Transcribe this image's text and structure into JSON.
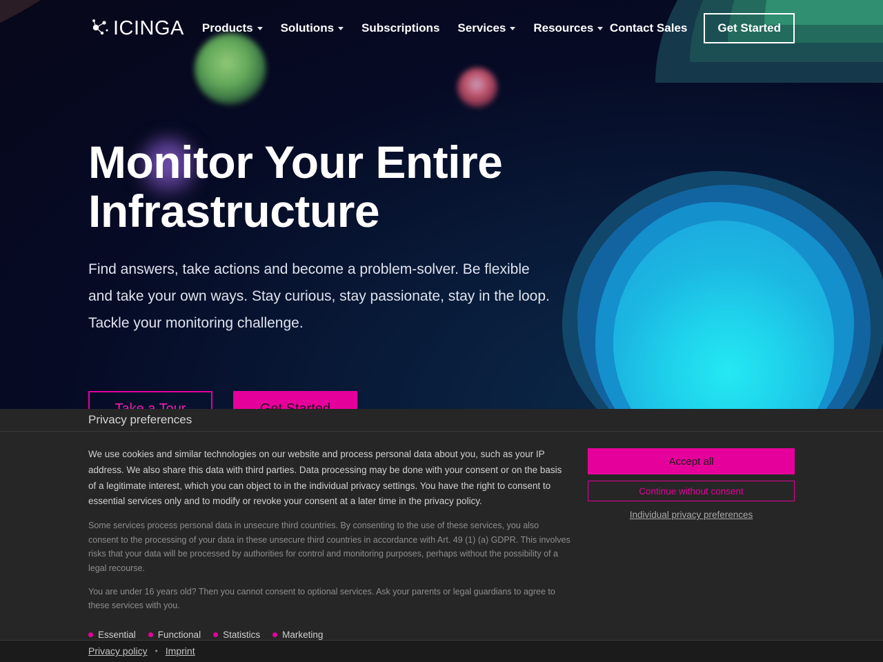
{
  "header": {
    "logo_text": "ICINGA",
    "logo_icon": "network-nodes-icon",
    "nav": [
      {
        "label": "Products",
        "has_caret": true
      },
      {
        "label": "Solutions",
        "has_caret": true
      },
      {
        "label": "Subscriptions",
        "has_caret": false
      },
      {
        "label": "Services",
        "has_caret": true
      },
      {
        "label": "Resources",
        "has_caret": true
      }
    ],
    "contact_sales": "Contact Sales",
    "get_started": "Get Started"
  },
  "hero": {
    "title": "Monitor Your Entire Infrastructure",
    "subtitle": "Find answers, take actions and become a problem-solver. Be flexible and take your own ways. Stay curious, stay passionate, stay in the loop. Tackle your monitoring challenge.",
    "cta_primary": "Take a Tour",
    "cta_secondary": "Get Started"
  },
  "privacy": {
    "heading": "Privacy preferences",
    "paragraph_main": "We use cookies and similar technologies on our website and process personal data about you, such as your IP address. We also share this data with third parties. Data processing may be done with your consent or on the basis of a legitimate interest, which you can object to in the individual privacy settings. You have the right to consent to essential services only and to modify or revoke your consent at a later time in the privacy policy.",
    "paragraph_second": "Some services process personal data in unsecure third countries. By consenting to the use of these services, you also consent to the processing of your data in these unsecure third countries in accordance with Art. 49 (1) (a) GDPR. This involves risks that your data will be processed by authorities for control and monitoring purposes, perhaps without the possibility of a legal recourse.",
    "paragraph_third": "You are under 16 years old? Then you cannot consent to optional services. Ask your parents or legal guardians to agree to these services with you.",
    "categories": [
      {
        "label": "Essential"
      },
      {
        "label": "Functional"
      },
      {
        "label": "Statistics"
      },
      {
        "label": "Marketing"
      }
    ],
    "accept_all": "Accept all",
    "continue_without": "Continue without consent",
    "individual": "Individual privacy preferences",
    "footer_privacy_policy": "Privacy policy",
    "footer_separator": "•",
    "footer_imprint": "Imprint"
  },
  "colors": {
    "accent_magenta": "#e6009b",
    "banner_bg": "#262626",
    "banner_footer_bg": "#1b1b1b",
    "hero_bg": "#0a0a22",
    "blob_cyan": "#25e8f2"
  }
}
